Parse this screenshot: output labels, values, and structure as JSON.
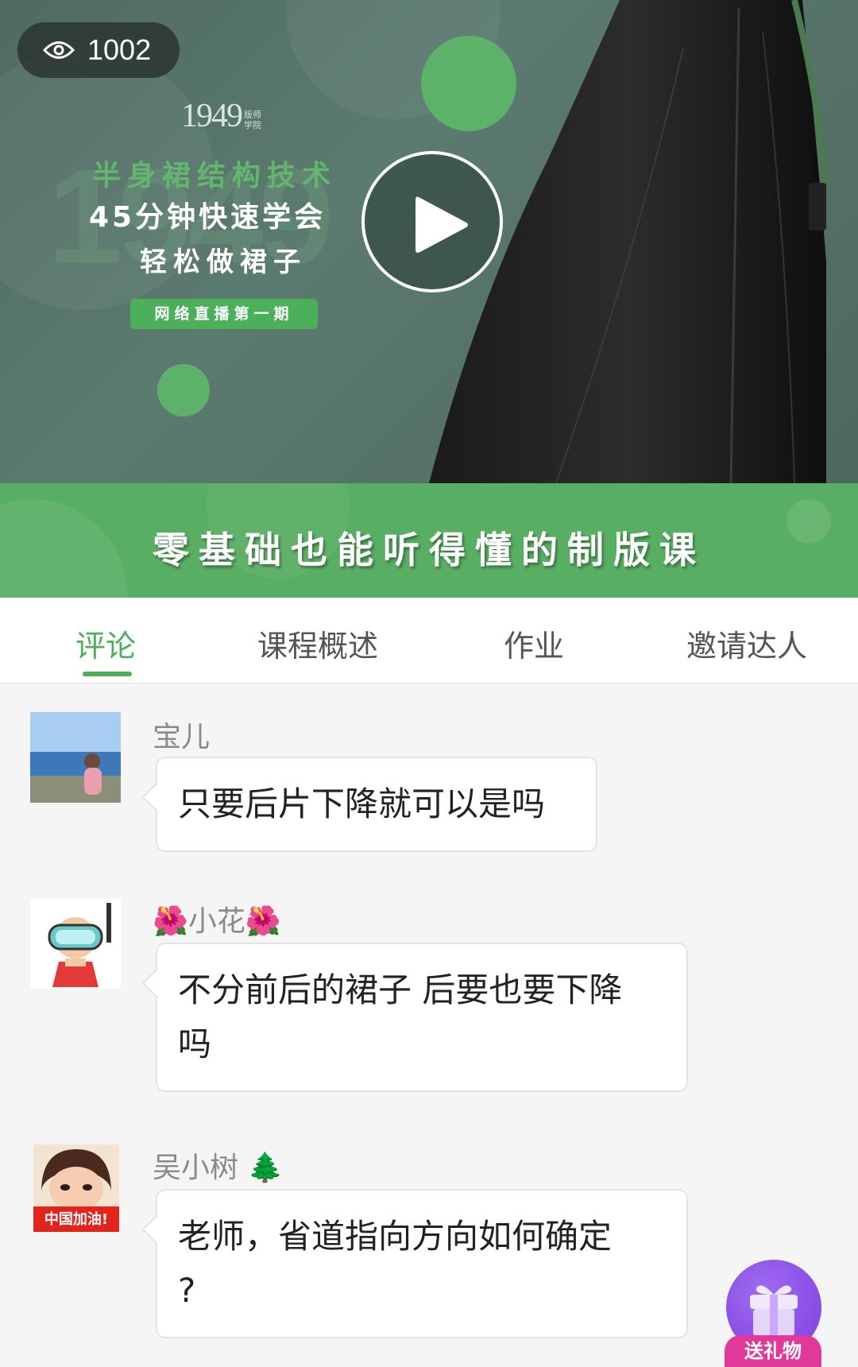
{
  "video": {
    "views": "1002",
    "logo": "1949",
    "logo_sub": "版师学院",
    "line1": "半身裙结构技术",
    "line2": "45分钟快速学会",
    "line3": "轻松做裙子",
    "badge": "网络直播第一期"
  },
  "banner": {
    "text": "零基础也能听得懂的制版课"
  },
  "tabs": [
    {
      "label": "评论",
      "active": true
    },
    {
      "label": "课程概述",
      "active": false
    },
    {
      "label": "作业",
      "active": false
    },
    {
      "label": "邀请达人",
      "active": false
    }
  ],
  "comments": [
    {
      "user": "宝儿",
      "text": "只要后片下降就可以是吗"
    },
    {
      "user": "🌺小花🌺",
      "text_line1": "不分前后的裙子 后要也要下降",
      "text_line2": "吗"
    },
    {
      "user": "吴小树 🌲",
      "text_line1": "老师，省道指向方向如何确定",
      "text_line2": "?",
      "avatar_caption": "中国加油!"
    }
  ],
  "gift": {
    "label": "送礼物"
  },
  "colors": {
    "accent": "#4caf5a",
    "gift": "#7b3fe0",
    "gift_label": "#e0399a"
  },
  "icons": [
    "eye-icon",
    "play-icon",
    "gift-icon"
  ]
}
